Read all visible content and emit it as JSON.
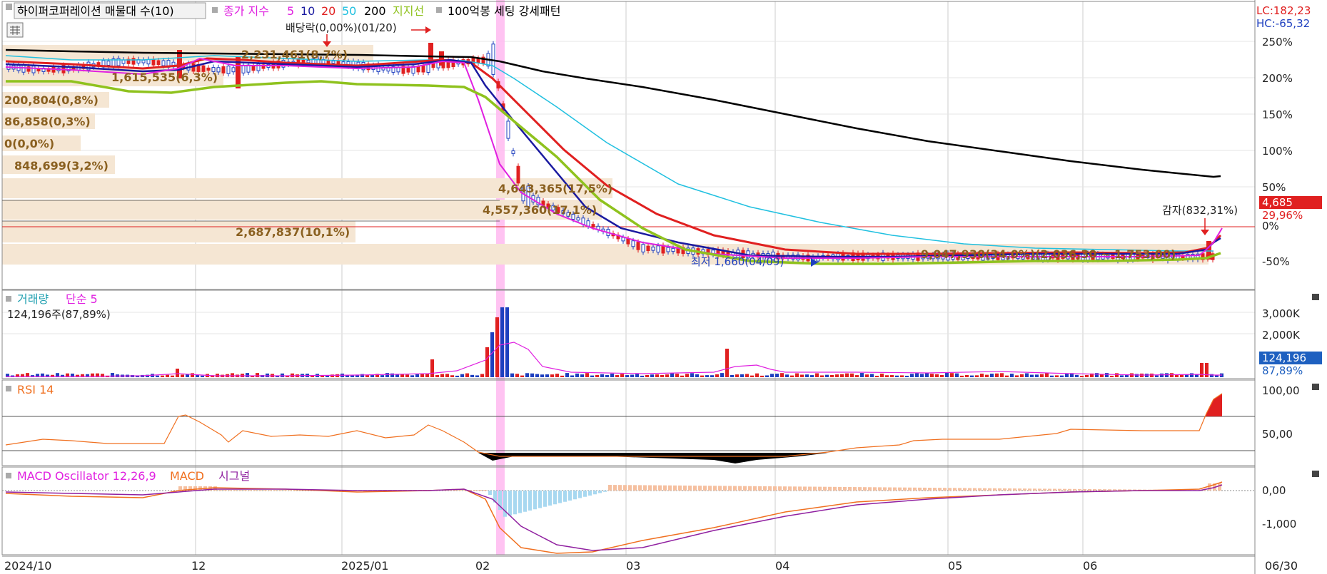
{
  "window": {
    "title_box": "하이퍼코퍼레이션 매물대 수(10)",
    "legend": [
      {
        "text": "종가 지수",
        "color": "#e020e0"
      },
      {
        "text": "5",
        "color": "#e020e0"
      },
      {
        "text": "10",
        "color": "#1a1aa0"
      },
      {
        "text": "20",
        "color": "#e02020"
      },
      {
        "text": "50",
        "color": "#20c0e0"
      },
      {
        "text": "200",
        "color": "#000000"
      },
      {
        "text": "지지선",
        "color": "#8fc21e"
      },
      {
        "text": "100억봉 세팅 강세패턴",
        "color": "#000000"
      }
    ],
    "lc": "LC:182,23",
    "hc": "HC:-65,32"
  },
  "price_panel": {
    "y_ticks": [
      "250%",
      "200%",
      "150%",
      "100%",
      "50%",
      "0%",
      "-50%"
    ],
    "current_price": "4,685",
    "current_pct": "29,96%",
    "annotations": {
      "dividend": "배당락(0,00%)(01/20)",
      "min_label": "최저 1,660(04/09)",
      "capital_reduction": "감자(832,31%)"
    },
    "volume_profile": [
      "1,615,535(6,3%)",
      "200,804(0,8%)",
      "86,858(0,3%)",
      "0(0,0%)",
      "848,699(3,2%)",
      "4,643,365(17,5%)",
      "4,557,360(17,1%)",
      "2,687,837(10,1%)",
      "2,231,461(8,7%)",
      "9,047,930(34,0%)(2,036,30 ~ 1,753,00)"
    ]
  },
  "volume_panel": {
    "title": "거래량",
    "ma_label": "단순 5",
    "value_text": "124,196주(87,89%)",
    "y_ticks": [
      "3,000K",
      "2,000K"
    ],
    "current": "124,196",
    "current_pct": "87,89%"
  },
  "rsi_panel": {
    "title": "RSI 14",
    "y_ticks": [
      "100,00",
      "50,00"
    ]
  },
  "macd_panel": {
    "osc_label": "MACD Oscillator 12,26,9",
    "macd_label": "MACD",
    "signal_label": "시그널",
    "y_ticks": [
      "0,00",
      "-1,000"
    ]
  },
  "x_axis": {
    "labels": [
      "2024/10",
      "12",
      "2025/01",
      "02",
      "03",
      "04",
      "05",
      "06",
      "06/30"
    ]
  },
  "colors": {
    "up": "#e02020",
    "down": "#1e3fbf",
    "ma5": "#e020e0",
    "ma10": "#1a1aa0",
    "ma20": "#e02020",
    "ma50": "#20c0e0",
    "ma200": "#000000",
    "support": "#8fc21e",
    "rsi": "#f07020",
    "macd": "#f07020",
    "signal": "#9020a0",
    "highlight": "#ffb8f0",
    "profile": "#f5e6d3"
  }
}
